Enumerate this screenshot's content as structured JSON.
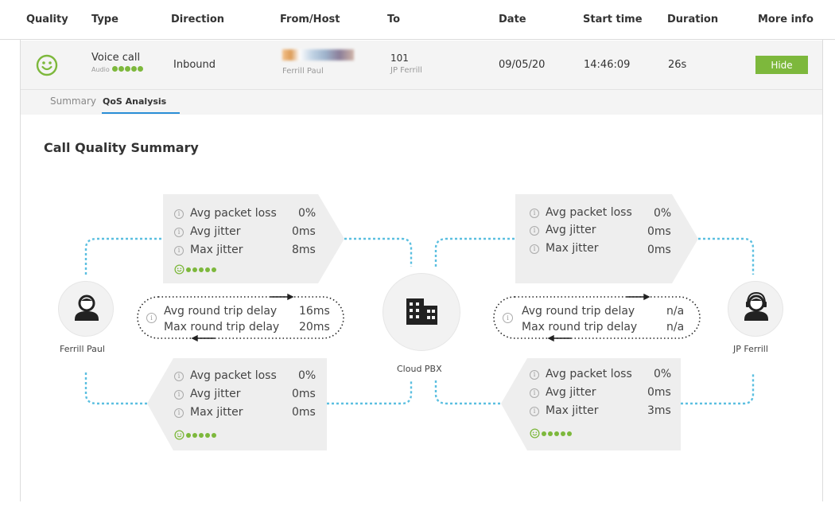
{
  "header": {
    "quality": "Quality",
    "type": "Type",
    "direction": "Direction",
    "from_host": "From/Host",
    "to": "To",
    "date": "Date",
    "start_time": "Start time",
    "duration": "Duration",
    "more_info": "More info"
  },
  "call": {
    "quality_icon": "smiley-icon",
    "type": "Voice call",
    "subtype": "Audio",
    "audio_quality": 5,
    "direction": "Inbound",
    "from_name": "Ferrill Paul",
    "to_number": "101",
    "to_name": "JP Ferrill",
    "date": "09/05/20",
    "start_time": "14:46:09",
    "duration": "26s",
    "more_info_button": "Hide"
  },
  "tabs": [
    {
      "label": "Summary",
      "active": false
    },
    {
      "label": "QoS Analysis",
      "active": true
    }
  ],
  "section_title": "Call Quality Summary",
  "nodes": {
    "left": {
      "label": "Ferrill Paul",
      "icon": "user-icon"
    },
    "center": {
      "label": "Cloud PBX",
      "icon": "building-icon"
    },
    "right": {
      "label": "JP Ferrill",
      "icon": "headset-user-icon"
    }
  },
  "labels": {
    "avg_packet_loss": "Avg packet loss",
    "avg_jitter": "Avg jitter",
    "max_jitter": "Max jitter",
    "avg_rtd": "Avg round trip delay",
    "max_rtd": "Max round trip delay"
  },
  "legs": {
    "left_top": {
      "avg_packet_loss": "0%",
      "avg_jitter": "0ms",
      "max_jitter": "8ms",
      "quality": 5
    },
    "left_bottom": {
      "avg_packet_loss": "0%",
      "avg_jitter": "0ms",
      "max_jitter": "0ms",
      "quality": 5
    },
    "right_top": {
      "avg_packet_loss": "0%",
      "avg_jitter": "0ms",
      "max_jitter": "0ms"
    },
    "right_bottom": {
      "avg_packet_loss": "0%",
      "avg_jitter": "0ms",
      "max_jitter": "3ms",
      "quality": 5
    }
  },
  "round_trip": {
    "left": {
      "avg": "16ms",
      "max": "20ms"
    },
    "right": {
      "avg": "n/a",
      "max": "n/a"
    }
  },
  "colors": {
    "accent_green": "#7db83c",
    "tab_blue": "#2a8ed6",
    "link_dash": "#5bbfe0"
  }
}
